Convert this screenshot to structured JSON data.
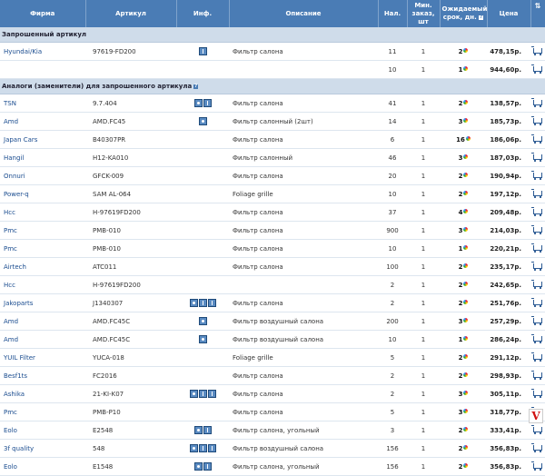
{
  "header": {
    "firm": "Фирма",
    "article": "Артикул",
    "info": "Инф.",
    "description": "Описание",
    "avail": "Нал.",
    "min_order": "Мин. заказ, шт",
    "expected": "Ожидаемый срок, дн.",
    "price": "Цена",
    "sort_icon": "sort-icon"
  },
  "sections": [
    {
      "title": "Запрошенный артикул",
      "help": false,
      "rows": [
        {
          "firm": "Hyundai/Kia",
          "article": "97619-FD200",
          "icons": [
            "info"
          ],
          "desc": "Фильтр салона",
          "avail": "11",
          "min": "1",
          "days": "2",
          "price": "478,15р."
        },
        {
          "firm": "",
          "article": "",
          "icons": [],
          "desc": "",
          "avail": "10",
          "min": "1",
          "days": "1",
          "price": "944,60р."
        }
      ]
    },
    {
      "title": "Аналоги (заменители) для запрошенного артикула",
      "help": true,
      "rows": [
        {
          "firm": "TSN",
          "article": "9.7.404",
          "icons": [
            "cam",
            "info"
          ],
          "desc": "Фильтр салона",
          "avail": "41",
          "min": "1",
          "days": "2",
          "price": "138,57р."
        },
        {
          "firm": "Amd",
          "article": "AMD.FC45",
          "icons": [
            "cam"
          ],
          "desc": "Фильтр салонный (2шт)",
          "avail": "14",
          "min": "1",
          "days": "3",
          "price": "185,73р."
        },
        {
          "firm": "Japan Cars",
          "article": "B40307PR",
          "icons": [],
          "desc": "Фильтр салона",
          "avail": "6",
          "min": "1",
          "days": "16",
          "price": "186,06р."
        },
        {
          "firm": "Hangil",
          "article": "H12-KA010",
          "icons": [],
          "desc": "Фильтр салонный",
          "avail": "46",
          "min": "1",
          "days": "3",
          "price": "187,03р."
        },
        {
          "firm": "Onnuri",
          "article": "GFCK-009",
          "icons": [],
          "desc": "Фильтр салона",
          "avail": "20",
          "min": "1",
          "days": "2",
          "price": "190,94р."
        },
        {
          "firm": "Power-q",
          "article": "SAM AL-064",
          "icons": [],
          "desc": "Foliage grille",
          "avail": "10",
          "min": "1",
          "days": "2",
          "price": "197,12р."
        },
        {
          "firm": "Hcc",
          "article": "H-97619FD200",
          "icons": [],
          "desc": "Фильтр салона",
          "avail": "37",
          "min": "1",
          "days": "4",
          "price": "209,48р."
        },
        {
          "firm": "Pmc",
          "article": "PMB-010",
          "icons": [],
          "desc": "Фильтр салона",
          "avail": "900",
          "min": "1",
          "days": "3",
          "price": "214,03р."
        },
        {
          "firm": "Pmc",
          "article": "PMB-010",
          "icons": [],
          "desc": "Фильтр салона",
          "avail": "10",
          "min": "1",
          "days": "1",
          "price": "220,21р."
        },
        {
          "firm": "Airtech",
          "article": "ATC011",
          "icons": [],
          "desc": "Фильтр салона",
          "avail": "100",
          "min": "1",
          "days": "2",
          "price": "235,17р."
        },
        {
          "firm": "Hcc",
          "article": "H-97619FD200",
          "icons": [],
          "desc": "",
          "avail": "2",
          "min": "1",
          "days": "2",
          "price": "242,65р."
        },
        {
          "firm": "Jakoparts",
          "article": "J1340307",
          "icons": [
            "cam",
            "info",
            "info"
          ],
          "desc": "Фильтр салона",
          "avail": "2",
          "min": "1",
          "days": "2",
          "price": "251,76р."
        },
        {
          "firm": "Amd",
          "article": "AMD.FC45C",
          "icons": [
            "cam"
          ],
          "desc": "Фильтр воздушный салона",
          "avail": "200",
          "min": "1",
          "days": "3",
          "price": "257,29р."
        },
        {
          "firm": "Amd",
          "article": "AMD.FC45C",
          "icons": [
            "cam"
          ],
          "desc": "Фильтр воздушный салона",
          "avail": "10",
          "min": "1",
          "days": "1",
          "price": "286,24р."
        },
        {
          "firm": "YUIL Filter",
          "article": "YUCA-018",
          "icons": [],
          "desc": "Foliage grille",
          "avail": "5",
          "min": "1",
          "days": "2",
          "price": "291,12р."
        },
        {
          "firm": "Besf1ts",
          "article": "FC2016",
          "icons": [],
          "desc": "Фильтр салона",
          "avail": "2",
          "min": "1",
          "days": "2",
          "price": "298,93р."
        },
        {
          "firm": "Ashika",
          "article": "21-KI-K07",
          "icons": [
            "cam",
            "info",
            "info"
          ],
          "desc": "Фильтр салона",
          "avail": "2",
          "min": "1",
          "days": "3",
          "price": "305,11р."
        },
        {
          "firm": "Pmc",
          "article": "PMB-P10",
          "icons": [],
          "desc": "Фильтр салона",
          "avail": "5",
          "min": "1",
          "days": "3",
          "price": "318,77р."
        },
        {
          "firm": "Eolo",
          "article": "E2548",
          "icons": [
            "cam",
            "info"
          ],
          "desc": "Фильтр салона, угольный",
          "avail": "3",
          "min": "1",
          "days": "2",
          "price": "333,41р."
        },
        {
          "firm": "3f quality",
          "article": "548",
          "icons": [
            "cam",
            "info",
            "info"
          ],
          "desc": "Фильтр воздушный салона",
          "avail": "156",
          "min": "1",
          "days": "2",
          "price": "356,83р."
        },
        {
          "firm": "Eolo",
          "article": "E1548",
          "icons": [
            "cam",
            "info"
          ],
          "desc": "Фильтр салона, угольный",
          "avail": "156",
          "min": "1",
          "days": "2",
          "price": "356,83р."
        }
      ]
    }
  ],
  "colors": {
    "header_bg": "#4a7cb5",
    "section_bg": "#cfdcea",
    "link": "#1a4c8f"
  },
  "logo_text": "V"
}
